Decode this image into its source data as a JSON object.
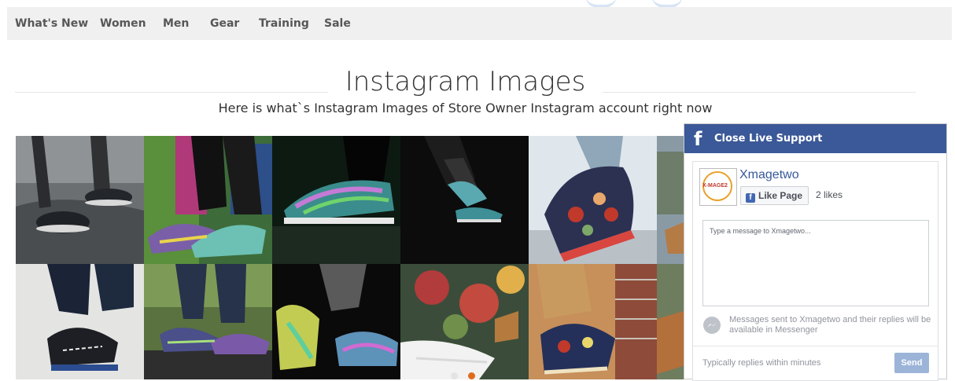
{
  "nav": {
    "items": [
      {
        "label": "What's New"
      },
      {
        "label": "Women"
      },
      {
        "label": "Men"
      },
      {
        "label": "Gear"
      },
      {
        "label": "Training"
      },
      {
        "label": "Sale"
      }
    ]
  },
  "page": {
    "title": "Instagram Images",
    "subtitle": "Here is what`s Instagram Images of Store Owner Instagram account right now"
  },
  "gallery": {
    "row_count": 2,
    "visible_columns": 6
  },
  "facebook_widget": {
    "header_icon": "facebook-f-icon",
    "header_label": "Close Live Support",
    "logo_text": "X-MAGE2",
    "page_name": "Xmagetwo",
    "like_button": "Like Page",
    "likes": "2 likes",
    "message_placeholder": "Type a message to Xmagetwo...",
    "messenger_note": "Messages sent to Xmagetwo and their replies will be available in Messenger",
    "reply_time": "Typically replies within minutes",
    "send_label": "Send",
    "colors": {
      "header": "#3b5998",
      "link": "#365899",
      "send": "#9cb4d8"
    }
  }
}
